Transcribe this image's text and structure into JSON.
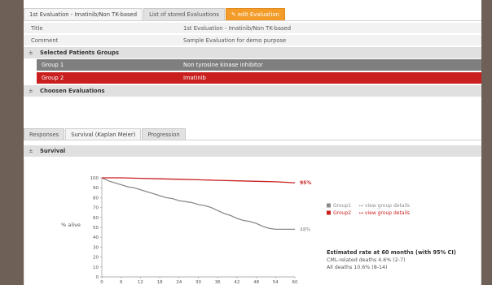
{
  "top_tabs": [
    "1st Evaluation - Imatinib/Non TK-based",
    "List of stored Evaluations",
    "edit Evaluation"
  ],
  "title_row": {
    "label": "Title",
    "value": "1st Evaluation - Imatinib/Non TK-based"
  },
  "comment_row": {
    "label": "Comment",
    "value": "Sample Evaluation for demo purpose"
  },
  "expander_symbol": "±",
  "selected_groups_header": "Selected Patients Groups",
  "groups": [
    {
      "label": "Group 1",
      "value": "Non tyrosine kinase inhibitor",
      "color": "#7f7f7f"
    },
    {
      "label": "Group 2",
      "value": "Imatinib",
      "color": "#c91f1f"
    }
  ],
  "chosen_header": "Choosen Evaluations",
  "result_tabs": [
    "Responses",
    "Survival (Kaplan Meier)",
    "Progression"
  ],
  "survival_header": "Survival",
  "chart_data": {
    "type": "line",
    "ylabel": "% alive",
    "xlabel": "",
    "x_ticks": [
      0,
      6,
      12,
      18,
      24,
      30,
      36,
      42,
      48,
      54,
      60
    ],
    "y_ticks": [
      0,
      10,
      20,
      30,
      40,
      50,
      60,
      70,
      80,
      90,
      100
    ],
    "xlim": [
      0,
      60
    ],
    "ylim": [
      0,
      100
    ],
    "grid": false,
    "legend_placement": "right",
    "series": [
      {
        "name": "Group1",
        "color": "#8a8a8a",
        "end_label": "48%",
        "x": [
          0,
          2,
          4,
          6,
          8,
          10,
          12,
          14,
          16,
          18,
          20,
          22,
          24,
          26,
          28,
          30,
          32,
          34,
          36,
          38,
          40,
          42,
          44,
          46,
          48,
          50,
          52,
          54,
          56,
          58,
          60
        ],
        "y": [
          100,
          97,
          95,
          93,
          91,
          90,
          88,
          86,
          84,
          82,
          80,
          79,
          77,
          76,
          75,
          73,
          72,
          70,
          67,
          64,
          62,
          59,
          57,
          56,
          54,
          51,
          49,
          48,
          48,
          48,
          48
        ]
      },
      {
        "name": "Group2",
        "color": "#c91f1f",
        "end_label": "95%",
        "x": [
          0,
          6,
          12,
          18,
          24,
          30,
          36,
          42,
          48,
          54,
          60
        ],
        "y": [
          100,
          100,
          99.5,
          99,
          98.5,
          98,
          97.5,
          97,
          96.5,
          96,
          95
        ]
      }
    ],
    "legend_links": "view group details",
    "estimate": {
      "title": "Estimated rate at 60 months (with 95% CI)",
      "lines": [
        "CML-related deaths 4.6% (2-7)",
        "All deaths 10.6% (8-14)"
      ]
    }
  }
}
